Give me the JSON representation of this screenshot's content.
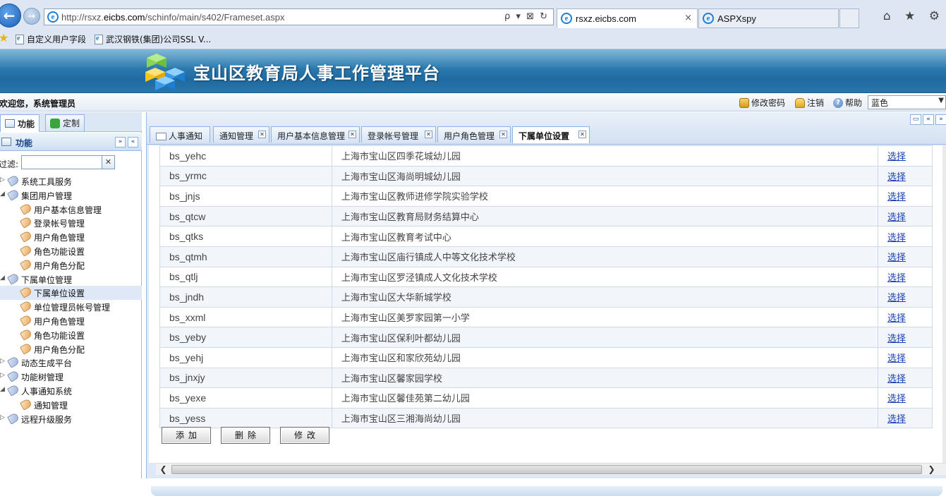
{
  "browser": {
    "address_prefix": "http://rsxz.",
    "address_domain": "eicbs.com",
    "address_path": "/schinfo/main/s402/Frameset.aspx",
    "address_tools": "ρ ▾ ⊠ ↻",
    "tabs": [
      {
        "label": "rsxz.eicbs.com",
        "active": true,
        "close": "×"
      },
      {
        "label": "ASPXspy",
        "active": false
      }
    ],
    "favorites": [
      "自定义用户字段",
      "武汉钢铁(集团)公司SSL V..."
    ],
    "chrome_icons": "⌂ ★ ⚙"
  },
  "app": {
    "title": "宝山区教育局人事工作管理平台",
    "banner_color": "#2f7fb3"
  },
  "userbar": {
    "welcome": "欢迎您，系统管理员",
    "change_password": "修改密码",
    "logout": "注销",
    "help": "帮助",
    "help_glyph": "?",
    "theme_value": "蓝色",
    "theme_arrow": "▼"
  },
  "left": {
    "tabs": [
      {
        "label": "功能",
        "active": true
      },
      {
        "label": "定制",
        "active": false
      }
    ],
    "panel_title": "功能",
    "collapse_glyph": "«",
    "expand_glyph": "»",
    "filter_label": "过滤:",
    "filter_value": "",
    "filter_clear": "✕",
    "tree": [
      {
        "label": "系统工具服务",
        "level": 0,
        "expanded": false
      },
      {
        "label": "集团用户管理",
        "level": 0,
        "expanded": true
      },
      {
        "label": "用户基本信息管理",
        "level": 1
      },
      {
        "label": "登录帐号管理",
        "level": 1
      },
      {
        "label": "用户角色管理",
        "level": 1
      },
      {
        "label": "角色功能设置",
        "level": 1
      },
      {
        "label": "用户角色分配",
        "level": 1
      },
      {
        "label": "下属单位管理",
        "level": 0,
        "expanded": true
      },
      {
        "label": "下属单位设置",
        "level": 1,
        "selected": true
      },
      {
        "label": "单位管理员帐号管理",
        "level": 1
      },
      {
        "label": "用户角色管理",
        "level": 1
      },
      {
        "label": "角色功能设置",
        "level": 1
      },
      {
        "label": "用户角色分配",
        "level": 1
      },
      {
        "label": "动态生成平台",
        "level": 0,
        "expanded": false
      },
      {
        "label": "功能树管理",
        "level": 0,
        "expanded": false
      },
      {
        "label": "人事通知系统",
        "level": 0,
        "expanded": true
      },
      {
        "label": "通知管理",
        "level": 1
      },
      {
        "label": "远程升级服务",
        "level": 0,
        "expanded": false
      }
    ]
  },
  "main": {
    "strip_controls": [
      "▭",
      "«",
      "»"
    ],
    "tab_close": "✕",
    "tabs": [
      {
        "label": "人事通知",
        "closable": false,
        "active": false
      },
      {
        "label": "通知管理",
        "closable": true,
        "active": false
      },
      {
        "label": "用户基本信息管理",
        "closable": true,
        "active": false
      },
      {
        "label": "登录帐号管理",
        "closable": true,
        "active": false
      },
      {
        "label": "用户角色管理",
        "closable": true,
        "active": false
      },
      {
        "label": "下属单位设置",
        "closable": true,
        "active": true
      }
    ],
    "rows": [
      {
        "code": "bs_yehc",
        "name": "上海市宝山区四季花城幼儿园",
        "action": "选择"
      },
      {
        "code": "bs_yrmc",
        "name": "上海市宝山区海尚明城幼儿园",
        "action": "选择"
      },
      {
        "code": "bs_jnjs",
        "name": "上海市宝山区教师进修学院实验学校",
        "action": "选择"
      },
      {
        "code": "bs_qtcw",
        "name": "上海市宝山区教育局财务结算中心",
        "action": "选择"
      },
      {
        "code": "bs_qtks",
        "name": "上海市宝山区教育考试中心",
        "action": "选择"
      },
      {
        "code": "bs_qtmh",
        "name": "上海市宝山区庙行镇成人中等文化技术学校",
        "action": "选择"
      },
      {
        "code": "bs_qtlj",
        "name": "上海市宝山区罗泾镇成人文化技术学校",
        "action": "选择"
      },
      {
        "code": "bs_jndh",
        "name": "上海市宝山区大华新城学校",
        "action": "选择"
      },
      {
        "code": "bs_xxml",
        "name": "上海市宝山区美罗家园第一小学",
        "action": "选择"
      },
      {
        "code": "bs_yeby",
        "name": "上海市宝山区保利叶都幼儿园",
        "action": "选择"
      },
      {
        "code": "bs_yehj",
        "name": "上海市宝山区和家欣苑幼儿园",
        "action": "选择"
      },
      {
        "code": "bs_jnxjy",
        "name": "上海市宝山区馨家园学校",
        "action": "选择"
      },
      {
        "code": "bs_yexe",
        "name": "上海市宝山区馨佳苑第二幼儿园",
        "action": "选择"
      },
      {
        "code": "bs_yess",
        "name": "上海市宝山区三湘海尚幼儿园",
        "action": "选择"
      }
    ],
    "buttons": {
      "add": "添加",
      "delete": "删除",
      "edit": "修改"
    },
    "scroll_left": "❮",
    "scroll_right": "❯"
  }
}
